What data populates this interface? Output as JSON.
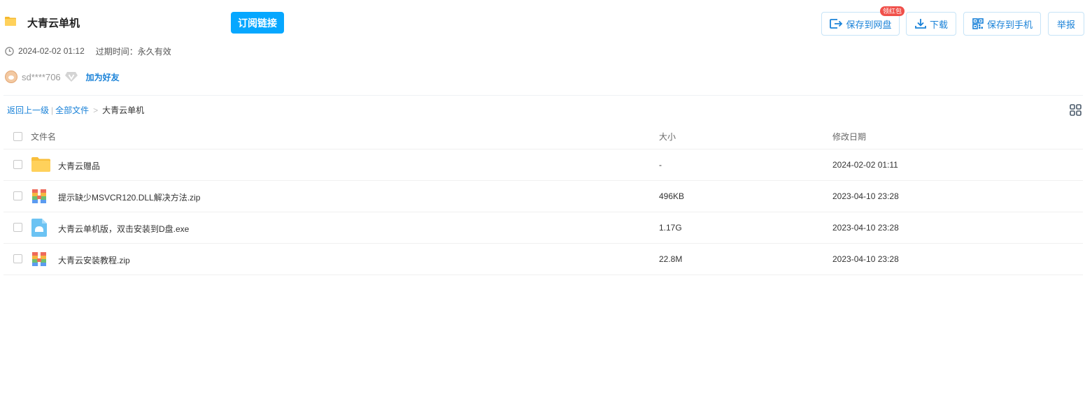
{
  "header": {
    "title": "大青云单机",
    "subscribe_label": "订阅链接",
    "created_time": "2024-02-02 01:12",
    "expire_text": "过期时间：永久有效"
  },
  "user": {
    "name": "sd****706",
    "add_friend_label": "加为好友"
  },
  "actions": {
    "save_cloud_label": "保存到网盘",
    "badge_label": "领红包",
    "download_label": "下载",
    "save_phone_label": "保存到手机",
    "report_label": "举报"
  },
  "breadcrumb": {
    "back_label": "返回上一级",
    "divider": "|",
    "all_files_label": "全部文件",
    "arrow": ">",
    "current_label": "大青云单机"
  },
  "table": {
    "headers": {
      "name": "文件名",
      "size": "大小",
      "date": "修改日期"
    },
    "rows": [
      {
        "icon": "folder-icon",
        "name": "大青云赠品",
        "size": "-",
        "date": "2024-02-02 01:11"
      },
      {
        "icon": "zip-icon",
        "name": "提示缺少MSVCR120.DLL解决方法.zip",
        "size": "496KB",
        "date": "2023-04-10 23:28"
      },
      {
        "icon": "exe-icon",
        "name": "大青云单机版，双击安装到D盘.exe",
        "size": "1.17G",
        "date": "2023-04-10 23:28"
      },
      {
        "icon": "zip-icon",
        "name": "大青云安装教程.zip",
        "size": "22.8M",
        "date": "2023-04-10 23:28"
      }
    ]
  },
  "colors": {
    "accent": "#06a7ff",
    "link": "#1a82d8",
    "badge": "#f0504a",
    "folder": "#ffd15b"
  }
}
